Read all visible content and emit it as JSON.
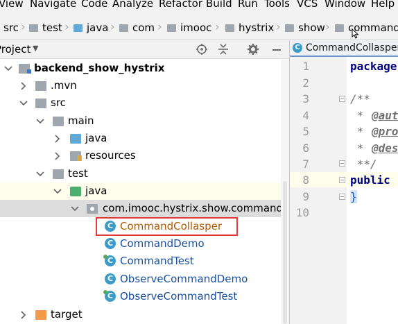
{
  "menu": [
    "View",
    "Navigate",
    "Code",
    "Analyze",
    "Refactor",
    "Build",
    "Run",
    "Tools",
    "VCS",
    "Window",
    "Help"
  ],
  "breadcrumb": [
    "src",
    "test",
    "java",
    "com",
    "imooc",
    "hystrix",
    "show",
    "command"
  ],
  "project_panel": {
    "title": "Project",
    "tree": [
      {
        "label": "backend_show_hystrix",
        "icon": "module-folder-icon",
        "expanded": true
      },
      {
        "label": ".mvn",
        "icon": "folder-icon",
        "expanded": false
      },
      {
        "label": "src",
        "icon": "folder-icon",
        "expanded": true
      },
      {
        "label": "main",
        "icon": "folder-icon",
        "expanded": true
      },
      {
        "label": "java",
        "icon": "source-folder-icon",
        "expanded": false
      },
      {
        "label": "resources",
        "icon": "resources-folder-icon",
        "expanded": false
      },
      {
        "label": "test",
        "icon": "folder-icon",
        "expanded": true
      },
      {
        "label": "java",
        "icon": "test-source-folder-icon",
        "expanded": true
      },
      {
        "label": "com.imooc.hystrix.show.command",
        "icon": "package-icon",
        "expanded": true
      },
      {
        "label": "CommandCollasper",
        "icon": "class-icon"
      },
      {
        "label": "CommandDemo",
        "icon": "class-icon"
      },
      {
        "label": "CommandTest",
        "icon": "test-class-icon"
      },
      {
        "label": "ObserveCommandDemo",
        "icon": "class-icon"
      },
      {
        "label": "ObserveCommandTest",
        "icon": "test-class-icon"
      },
      {
        "label": "target",
        "icon": "excluded-folder-icon",
        "expanded": false
      }
    ]
  },
  "editor": {
    "tab_label": "CommandCollasper",
    "line_numbers": [
      "1",
      "2",
      "3",
      "4",
      "5",
      "6",
      "7",
      "8",
      "9",
      "10"
    ],
    "code": {
      "l1": "package",
      "l3": "/**",
      "l4_star": " * ",
      "l4_tag": "@aut",
      "l5_star": " * ",
      "l5_tag": "@pro",
      "l6_star": " * ",
      "l6_tag": "@des",
      "l7": " **/",
      "l8": "public",
      "l9": "}"
    }
  },
  "colors": {
    "class_icon": "#3a9bc9",
    "highlight_box": "#e23a3a",
    "keyword": "#000080"
  }
}
